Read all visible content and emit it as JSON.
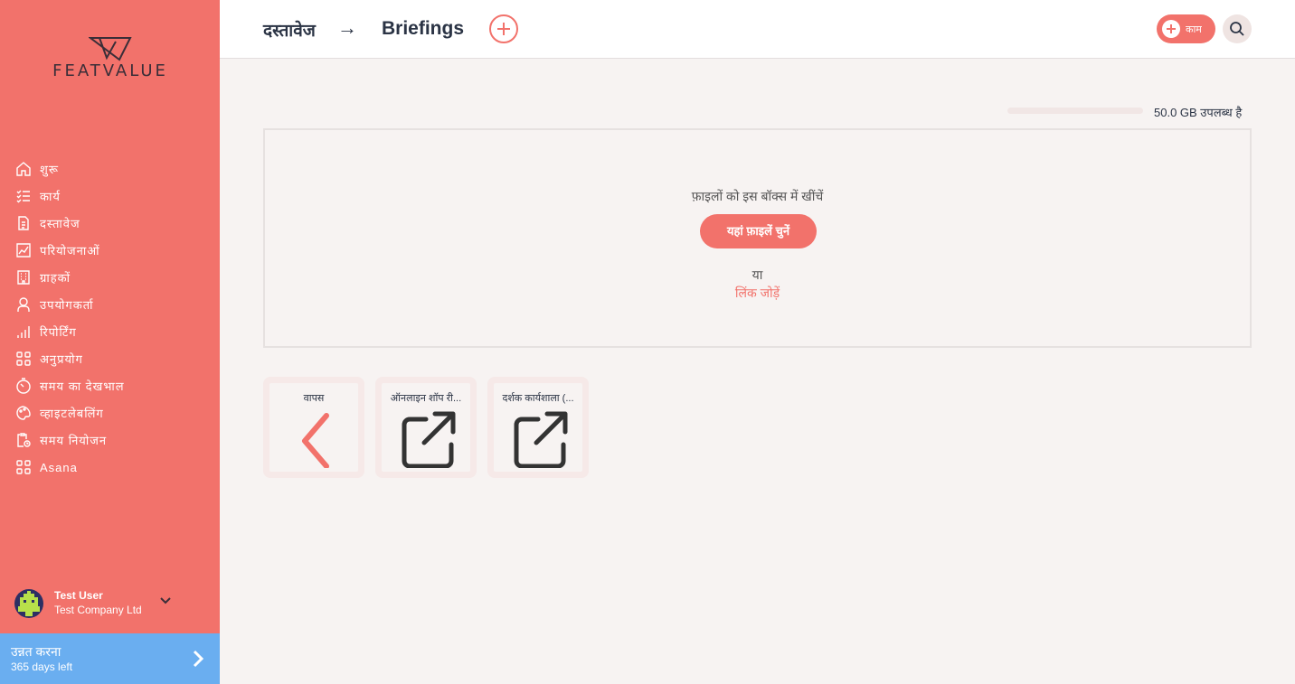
{
  "app": {
    "logo_text": "FEATVALUE"
  },
  "colors": {
    "brand": "#f2726b",
    "upgrade": "#6aaef0",
    "text": "#2b3445",
    "background": "#f7f3f2"
  },
  "sidebar": {
    "items": [
      {
        "label": "शुरू",
        "icon": "home-icon"
      },
      {
        "label": "कार्य",
        "icon": "task-list-icon"
      },
      {
        "label": "दस्तावेज",
        "icon": "document-icon"
      },
      {
        "label": "परियोजनाओं",
        "icon": "chart-icon"
      },
      {
        "label": "ग्राहकों",
        "icon": "building-icon"
      },
      {
        "label": "उपयोगकर्ता",
        "icon": "user-icon"
      },
      {
        "label": "रिपोर्टिंग",
        "icon": "bar-chart-icon"
      },
      {
        "label": "अनुप्रयोग",
        "icon": "apps-icon"
      },
      {
        "label": "समय का देखभाल",
        "icon": "timer-icon"
      },
      {
        "label": "व्हाइटलेबलिंग",
        "icon": "palette-icon"
      },
      {
        "label": "समय नियोजन",
        "icon": "clipboard-clock-icon"
      },
      {
        "label": "Asana",
        "icon": "apps-icon"
      }
    ],
    "user": {
      "name": "Test User",
      "company": "Test Company Ltd"
    },
    "upgrade": {
      "title": "उन्नत करना",
      "subtitle": "365 days left"
    }
  },
  "header": {
    "breadcrumb_root": "दस्तावेज",
    "breadcrumb_arrow": "→",
    "breadcrumb_current": "Briefings",
    "task_button_label": "काम"
  },
  "storage": {
    "available_text": "50.0 GB उपलब्ध है",
    "used_fraction": 0
  },
  "dropzone": {
    "instruction": "फ़ाइलों को इस बॉक्स में खींचें",
    "choose_button": "यहां फ़ाइलें चुनें",
    "or_text": "या",
    "add_link": "लिंक जोड़ें"
  },
  "tiles": [
    {
      "label": "वापस",
      "icon": "chevron-left-icon"
    },
    {
      "label": "ऑनलाइन शॉप री...",
      "icon": "external-link-icon"
    },
    {
      "label": "दर्शक कार्यशाला (...",
      "icon": "external-link-icon"
    }
  ]
}
